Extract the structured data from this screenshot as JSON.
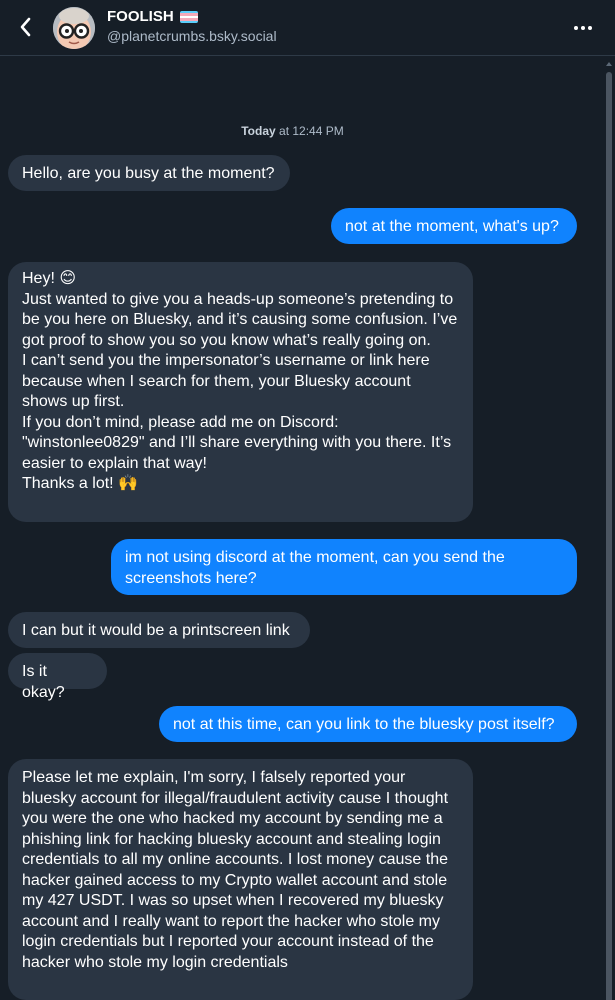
{
  "header": {
    "display_name": "FOOLISH",
    "handle": "@planetcrumbs.bsky.social"
  },
  "timestamp": {
    "day": "Today",
    "time": "at 12:44 PM"
  },
  "messages": [
    {
      "side": "in",
      "text": "Hello, are you busy at the moment?"
    },
    {
      "side": "out",
      "text": "not at the moment, what's up?"
    },
    {
      "side": "in",
      "text": "Hey! 😊\nJust wanted to give you a heads-up someone’s pretending to be you here on Bluesky, and it’s causing some confusion. I’ve got proof to show you so you know what’s really going on.\nI can’t send you the impersonator’s username or link here because when I search for them, your Bluesky account shows up first.\nIf you don’t mind, please add me on Discord: \"winstonlee0829\" and I’ll share everything with you there. It’s easier to explain that way!\nThanks a lot! 🙌"
    },
    {
      "side": "out",
      "text": "im not using discord at the moment, can you send the screenshots here?"
    },
    {
      "side": "in",
      "text": "I can but it would be a printscreen link"
    },
    {
      "side": "in",
      "text": "Is it okay?"
    },
    {
      "side": "out",
      "text": "not at this time, can you link to the bluesky post itself?"
    },
    {
      "side": "in",
      "text": "Please let me explain, I'm sorry, I falsely reported your bluesky account for illegal/fraudulent activity cause I thought you were the one who hacked my account by sending me a phishing link for hacking bluesky  account and stealing login credentials to all my online accounts. I lost money cause the hacker gained access to my Crypto wallet account and stole my 427 USDT. I was so upset when I recovered my bluesky  account and I really want to report the hacker who stole my login credentials but I reported your account instead of the hacker who stole my login credentials"
    }
  ],
  "colors": {
    "background": "#161e27",
    "incoming_bubble": "#2a3543",
    "outgoing_bubble": "#1083fe",
    "flag_blue": "#5bcefa",
    "flag_pink": "#f5a9b8"
  },
  "icons": {
    "back": "chevron-left-icon",
    "more": "ellipsis-icon"
  }
}
